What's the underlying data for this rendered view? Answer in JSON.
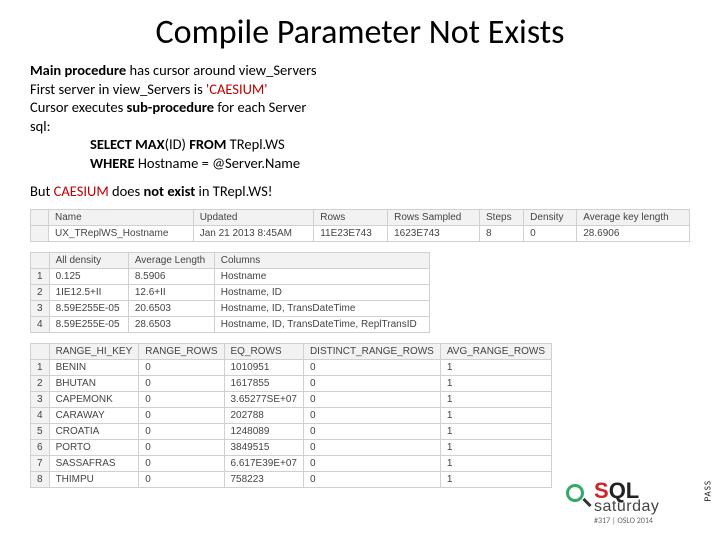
{
  "title": "Compile Parameter Not Exists",
  "lines": {
    "l1a": "Main procedure",
    "l1b": " has cursor around view_Servers",
    "l2a": "First server in view_Servers is ",
    "l2b": "'CAESIUM'",
    "l3a": "Cursor executes ",
    "l3b": "sub-procedure",
    "l3c": " for each Server",
    "l4": "sql:",
    "l5a": "SELECT MAX",
    "l5b": "(ID) ",
    "l5c": "FROM ",
    "l5d": "TRepl.WS",
    "l6a": "WHERE ",
    "l6b": "Hostname = @Server.Name",
    "l7a": "But ",
    "l7b": "CAESIUM",
    "l7c": " does ",
    "l7d": "not exist",
    "l7e": " in TRepl.WS!"
  },
  "table1": {
    "headers": [
      "",
      "Name",
      "Updated",
      "Rows",
      "Rows Sampled",
      "Steps",
      "Density",
      "Average key length"
    ],
    "row": [
      "",
      "UX_TReplWS_Hostname",
      "Jan 21 2013  8:45AM",
      "11E23E743",
      "1623E743",
      "8",
      "0",
      "28.6906"
    ]
  },
  "table2": {
    "headers": [
      "",
      "All density",
      "Average Length",
      "Columns"
    ],
    "rows": [
      [
        "1",
        "0.125",
        "8.5906",
        "Hostname"
      ],
      [
        "2",
        "1IE12.5+II",
        "12.6+II",
        "Hostname, ID"
      ],
      [
        "3",
        "8.59E255E-05",
        "20.6503",
        "Hostname, ID, TransDateTime"
      ],
      [
        "4",
        "8.59E255E-05",
        "28.6503",
        "Hostname, ID, TransDateTime, ReplTransID"
      ]
    ]
  },
  "table3": {
    "headers": [
      "",
      "RANGE_HI_KEY",
      "RANGE_ROWS",
      "EQ_ROWS",
      "DISTINCT_RANGE_ROWS",
      "AVG_RANGE_ROWS"
    ],
    "rows": [
      [
        "1",
        "BENIN",
        "0",
        "1010951",
        "0",
        "1"
      ],
      [
        "2",
        "BHUTAN",
        "0",
        "1617855",
        "0",
        "1"
      ],
      [
        "3",
        "CAPEMONK",
        "0",
        "3.65277SE+07",
        "0",
        "1"
      ],
      [
        "4",
        "CARAWAY",
        "0",
        "202788",
        "0",
        "1"
      ],
      [
        "5",
        "CROATIA",
        "0",
        "1248089",
        "0",
        "1"
      ],
      [
        "6",
        "PORTO",
        "0",
        "3849515",
        "0",
        "1"
      ],
      [
        "7",
        "SASSAFRAS",
        "0",
        "6.617E39E+07",
        "0",
        "1"
      ],
      [
        "8",
        "THIMPU",
        "0",
        "758223",
        "0",
        "1"
      ]
    ]
  },
  "logo": {
    "pass": "PASS",
    "sql": "SQL",
    "sat": "saturday",
    "sub": "#317 | OSLO 2014"
  }
}
